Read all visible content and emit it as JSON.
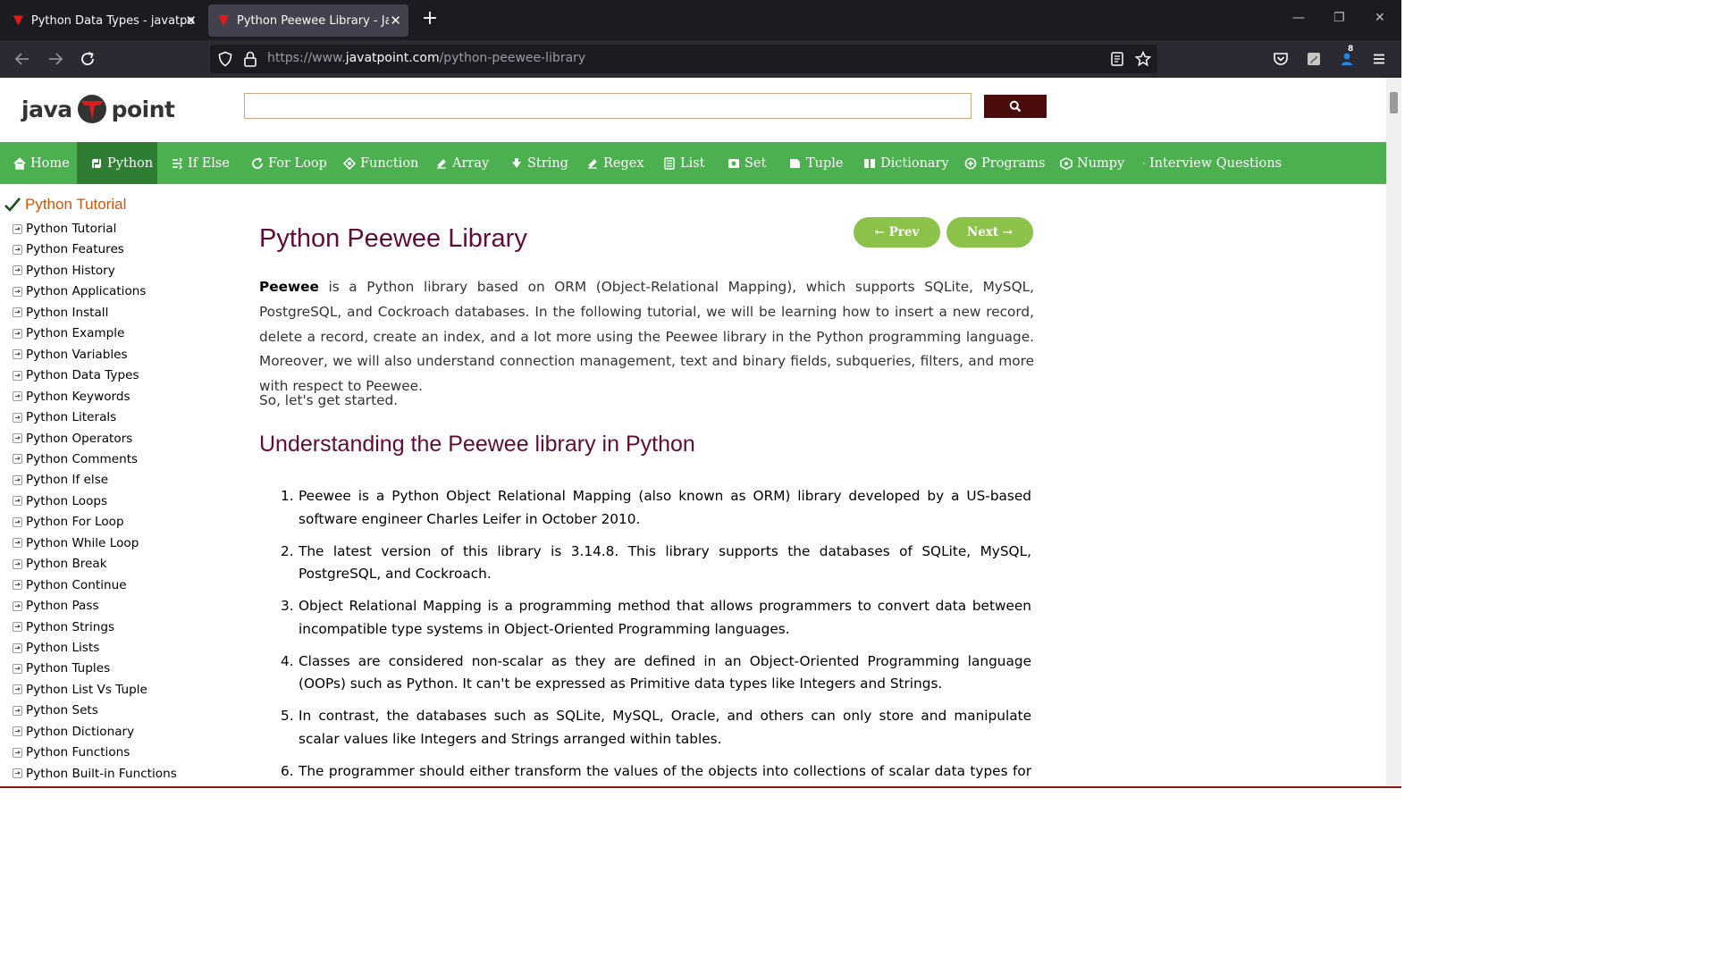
{
  "browser": {
    "tabs": [
      {
        "title": "Python Data Types - javatpoint",
        "active": false
      },
      {
        "title": "Python Peewee Library - Javatpoint",
        "active": true
      }
    ],
    "url": {
      "prefix": "https://www.",
      "host": "javatpoint.com",
      "path": "/python-peewee-library"
    },
    "extension_badge": "8",
    "icons": [
      "back-icon",
      "forward-icon",
      "reload-icon",
      "shield-icon",
      "lock-icon",
      "reader-view-icon",
      "bookmark-star-icon",
      "pocket-icon",
      "extension-icon",
      "account-icon",
      "menu-icon"
    ]
  },
  "site": {
    "logo_left": "java",
    "logo_right": "point",
    "search_placeholder": "",
    "menu": [
      {
        "label": "Home",
        "icon": "home-icon",
        "active": false
      },
      {
        "label": "Python",
        "icon": "python-icon",
        "active": true
      },
      {
        "label": "If Else",
        "icon": "branch-icon",
        "active": false
      },
      {
        "label": "For Loop",
        "icon": "loop-icon",
        "active": false
      },
      {
        "label": "Function",
        "icon": "function-icon",
        "active": false
      },
      {
        "label": "Array",
        "icon": "array-icon",
        "active": false
      },
      {
        "label": "String",
        "icon": "string-icon",
        "active": false
      },
      {
        "label": "Regex",
        "icon": "regex-icon",
        "active": false
      },
      {
        "label": "List",
        "icon": "list-icon",
        "active": false
      },
      {
        "label": "Set",
        "icon": "set-icon",
        "active": false
      },
      {
        "label": "Tuple",
        "icon": "tuple-icon",
        "active": false
      },
      {
        "label": "Dictionary",
        "icon": "dictionary-icon",
        "active": false
      },
      {
        "label": "Programs",
        "icon": "programs-icon",
        "active": false
      },
      {
        "label": "Numpy",
        "icon": "numpy-icon",
        "active": false
      },
      {
        "label": "Interview Questions",
        "icon": "interview-icon",
        "active": false
      }
    ],
    "colors": {
      "menu_green": "#4caf50",
      "menu_active": "#2e7d32",
      "title_maroon": "#610b38",
      "button_green": "#8bc34a",
      "sidebar_heading": "#d35400",
      "search_button": "#4a0b0b"
    }
  },
  "sidebar": {
    "heading": "Python Tutorial",
    "items": [
      "Python Tutorial",
      "Python Features",
      "Python History",
      "Python Applications",
      "Python Install",
      "Python Example",
      "Python Variables",
      "Python Data Types",
      "Python Keywords",
      "Python Literals",
      "Python Operators",
      "Python Comments",
      "Python If else",
      "Python Loops",
      "Python For Loop",
      "Python While Loop",
      "Python Break",
      "Python Continue",
      "Python Pass",
      "Python Strings",
      "Python Lists",
      "Python Tuples",
      "Python List Vs Tuple",
      "Python Sets",
      "Python Dictionary",
      "Python Functions",
      "Python Built-in Functions"
    ]
  },
  "article": {
    "title": "Python Peewee Library",
    "prev_label": "← Prev",
    "next_label": "Next →",
    "intro_bold": "Peewee",
    "intro_rest": " is a Python library based on ORM (Object-Relational Mapping), which supports SQLite, MySQL, PostgreSQL, and Cockroach databases. In the following tutorial, we will be learning how to insert a new record, delete a record, create an index, and a lot more using the Peewee library in the Python programming language. Moreover, we will also understand connection management, text and binary fields, subqueries, filters, and more with respect to Peewee.",
    "intro2": "So, let's get started.",
    "h2": "Understanding the Peewee library in Python",
    "list": [
      "Peewee is a Python Object Relational Mapping (also known as ORM) library developed by a US-based software engineer Charles Leifer in October 2010.",
      "The latest version of this library is 3.14.8. This library supports the databases of SQLite, MySQL, PostgreSQL, and Cockroach.",
      "Object Relational Mapping is a programming method that allows programmers to convert data between incompatible type systems in Object-Oriented Programming languages.",
      "Classes are considered non-scalar as they are defined in an Object-Oriented Programming language (OOPs) such as Python. It can't be expressed as Primitive data types like Integers and Strings.",
      "In contrast, the databases such as SQLite, MySQL, Oracle, and others can only store and manipulate scalar values like Integers and Strings arranged within tables.",
      "The programmer should either transform the values of the objects into collections of scalar data types for storing"
    ]
  }
}
